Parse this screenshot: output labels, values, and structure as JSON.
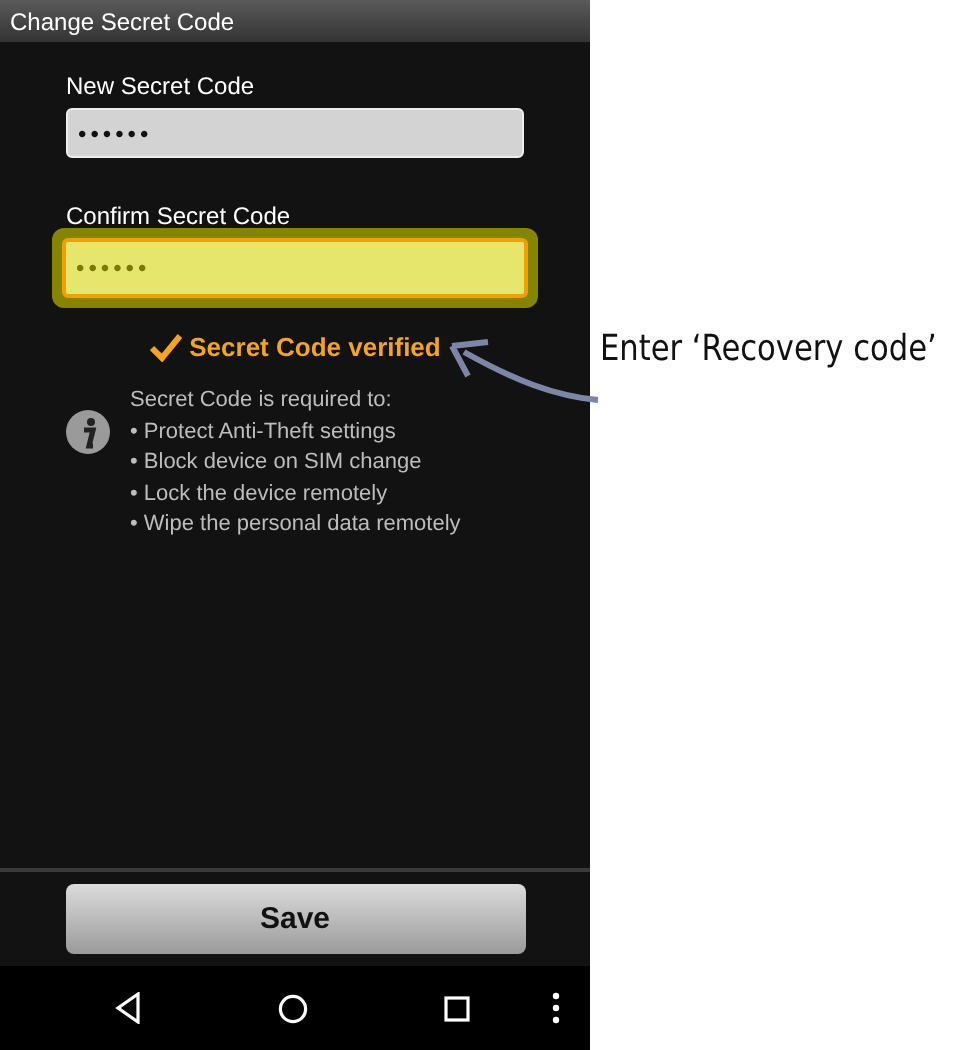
{
  "window": {
    "title": "Change Secret Code"
  },
  "fields": [
    {
      "label": "New Secret Code",
      "value": "••••••",
      "highlighted": false
    },
    {
      "label": "Confirm Secret Code",
      "value": "••••••",
      "highlighted": true
    }
  ],
  "status": {
    "text": "Secret Code verified",
    "verified": true
  },
  "info": {
    "lines": [
      "Secret Code is required to:",
      "• Protect Anti-Theft settings",
      "• Block device on SIM change",
      "• Lock the device remotely",
      "• Wipe the personal data remotely"
    ]
  },
  "save_button": {
    "label": "Save"
  },
  "callout": {
    "text": "Enter ‘Recovery code’"
  }
}
